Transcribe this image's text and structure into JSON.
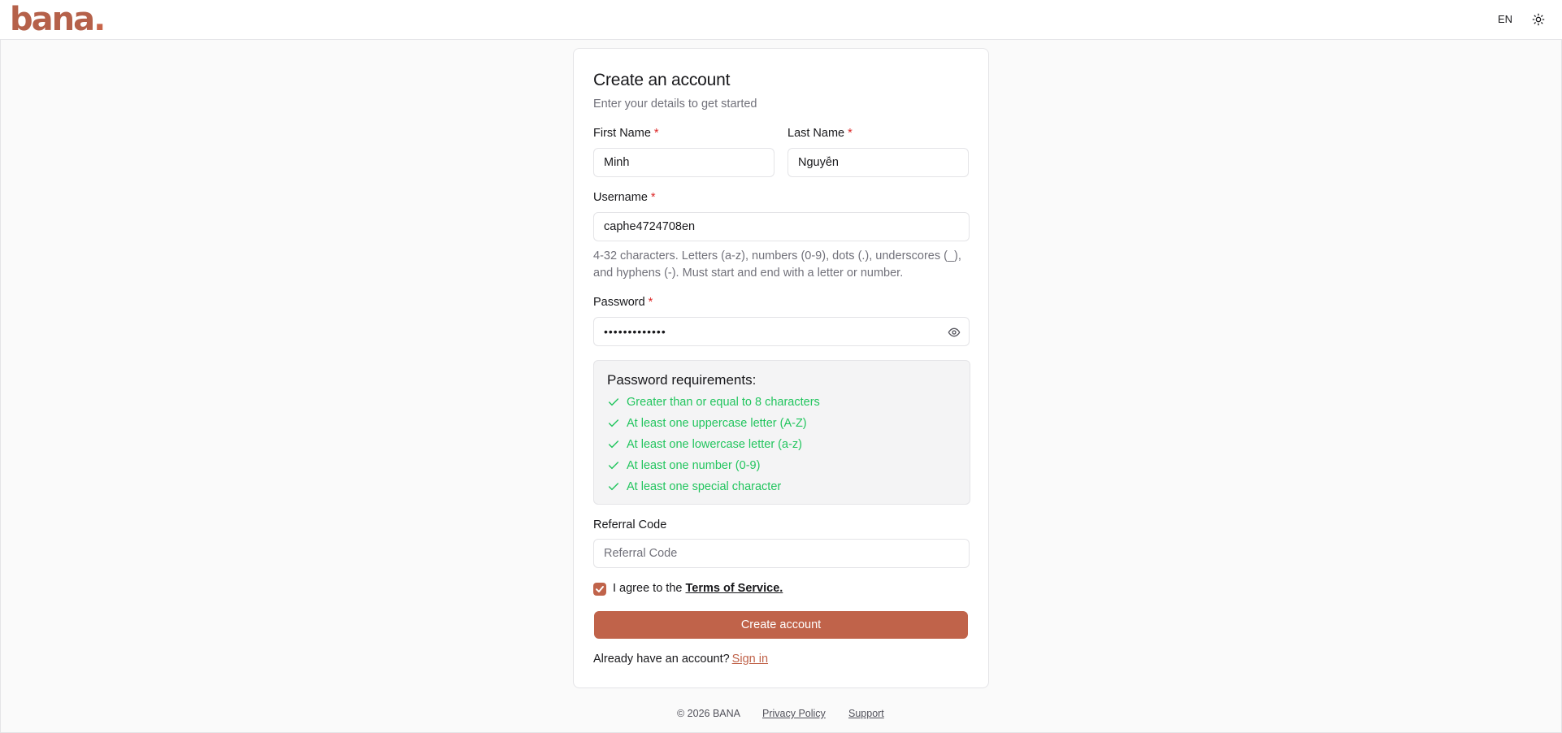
{
  "header": {
    "logo_main": "bana",
    "logo_dot": ".",
    "language": "EN",
    "theme_icon": "sun-icon"
  },
  "form": {
    "title": "Create an account",
    "subtitle": "Enter your details to get started",
    "required_marker": "*",
    "first_name": {
      "label": "First Name",
      "value": "Minh"
    },
    "last_name": {
      "label": "Last Name",
      "value": "Nguyễn"
    },
    "username": {
      "label": "Username",
      "value": "caphe4724708en",
      "hint": "4-32 characters. Letters (a-z), numbers (0-9), dots (.), underscores (_), and hyphens (-). Must start and end with a letter or number."
    },
    "password": {
      "label": "Password",
      "value": "•••••••••••••",
      "toggle_icon": "eye-icon"
    },
    "password_requirements": {
      "title": "Password requirements:",
      "items": [
        {
          "text": "Greater than or equal to 8 characters",
          "met": true
        },
        {
          "text": "At least one uppercase letter (A-Z)",
          "met": true
        },
        {
          "text": "At least one lowercase letter (a-z)",
          "met": true
        },
        {
          "text": "At least one number (0-9)",
          "met": true
        },
        {
          "text": "At least one special character",
          "met": true
        }
      ]
    },
    "referral": {
      "label": "Referral Code",
      "placeholder": "Referral Code",
      "value": ""
    },
    "agree": {
      "checked": true,
      "text": "I agree to the",
      "link": "Terms of Service."
    },
    "submit_label": "Create account",
    "signin_prompt": "Already have an account?",
    "signin_link": "Sign in"
  },
  "footer": {
    "copyright": "© 2026 BANA",
    "privacy": "Privacy Policy",
    "support": "Support"
  },
  "colors": {
    "brand": "#c0634a",
    "success": "#22c55e",
    "required": "#dc2626",
    "muted": "#71717a"
  }
}
